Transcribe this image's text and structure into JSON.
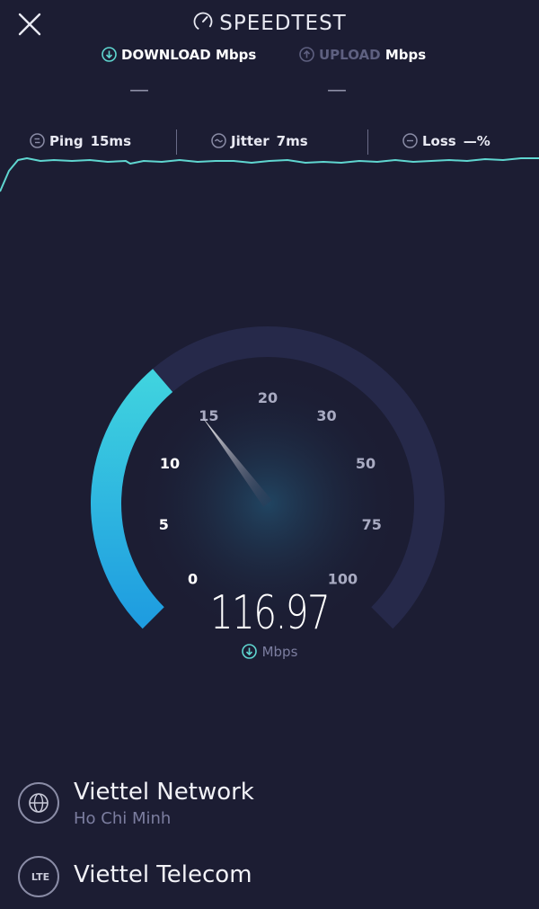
{
  "header": {
    "title": "SPEEDTEST"
  },
  "download": {
    "label": "DOWNLOAD",
    "unit": "Mbps",
    "value": "—"
  },
  "upload": {
    "label": "UPLOAD",
    "unit": "Mbps",
    "value": "—"
  },
  "stats": {
    "ping_label": "Ping",
    "ping_value": "15ms",
    "jitter_label": "Jitter",
    "jitter_value": "7ms",
    "loss_label": "Loss",
    "loss_value": "—%"
  },
  "gauge": {
    "ticks": [
      "0",
      "5",
      "10",
      "15",
      "20",
      "30",
      "50",
      "75",
      "100"
    ],
    "current_value": "116.97",
    "unit": "Mbps"
  },
  "server": {
    "provider": "Viettel Network",
    "location": "Ho Chi Minh",
    "isp": "Viettel Telecom",
    "isp_icon_label": "LTE"
  },
  "colors": {
    "background": "#1c1d33",
    "accent": "#37c3e0",
    "trace": "#5fd6d0"
  },
  "icons": {
    "close": "close-icon",
    "speedtest": "speedometer-icon",
    "download": "download-arrow-icon",
    "upload": "upload-arrow-icon",
    "ping": "ping-icon",
    "jitter": "jitter-icon",
    "loss": "loss-icon",
    "globe": "globe-icon"
  }
}
